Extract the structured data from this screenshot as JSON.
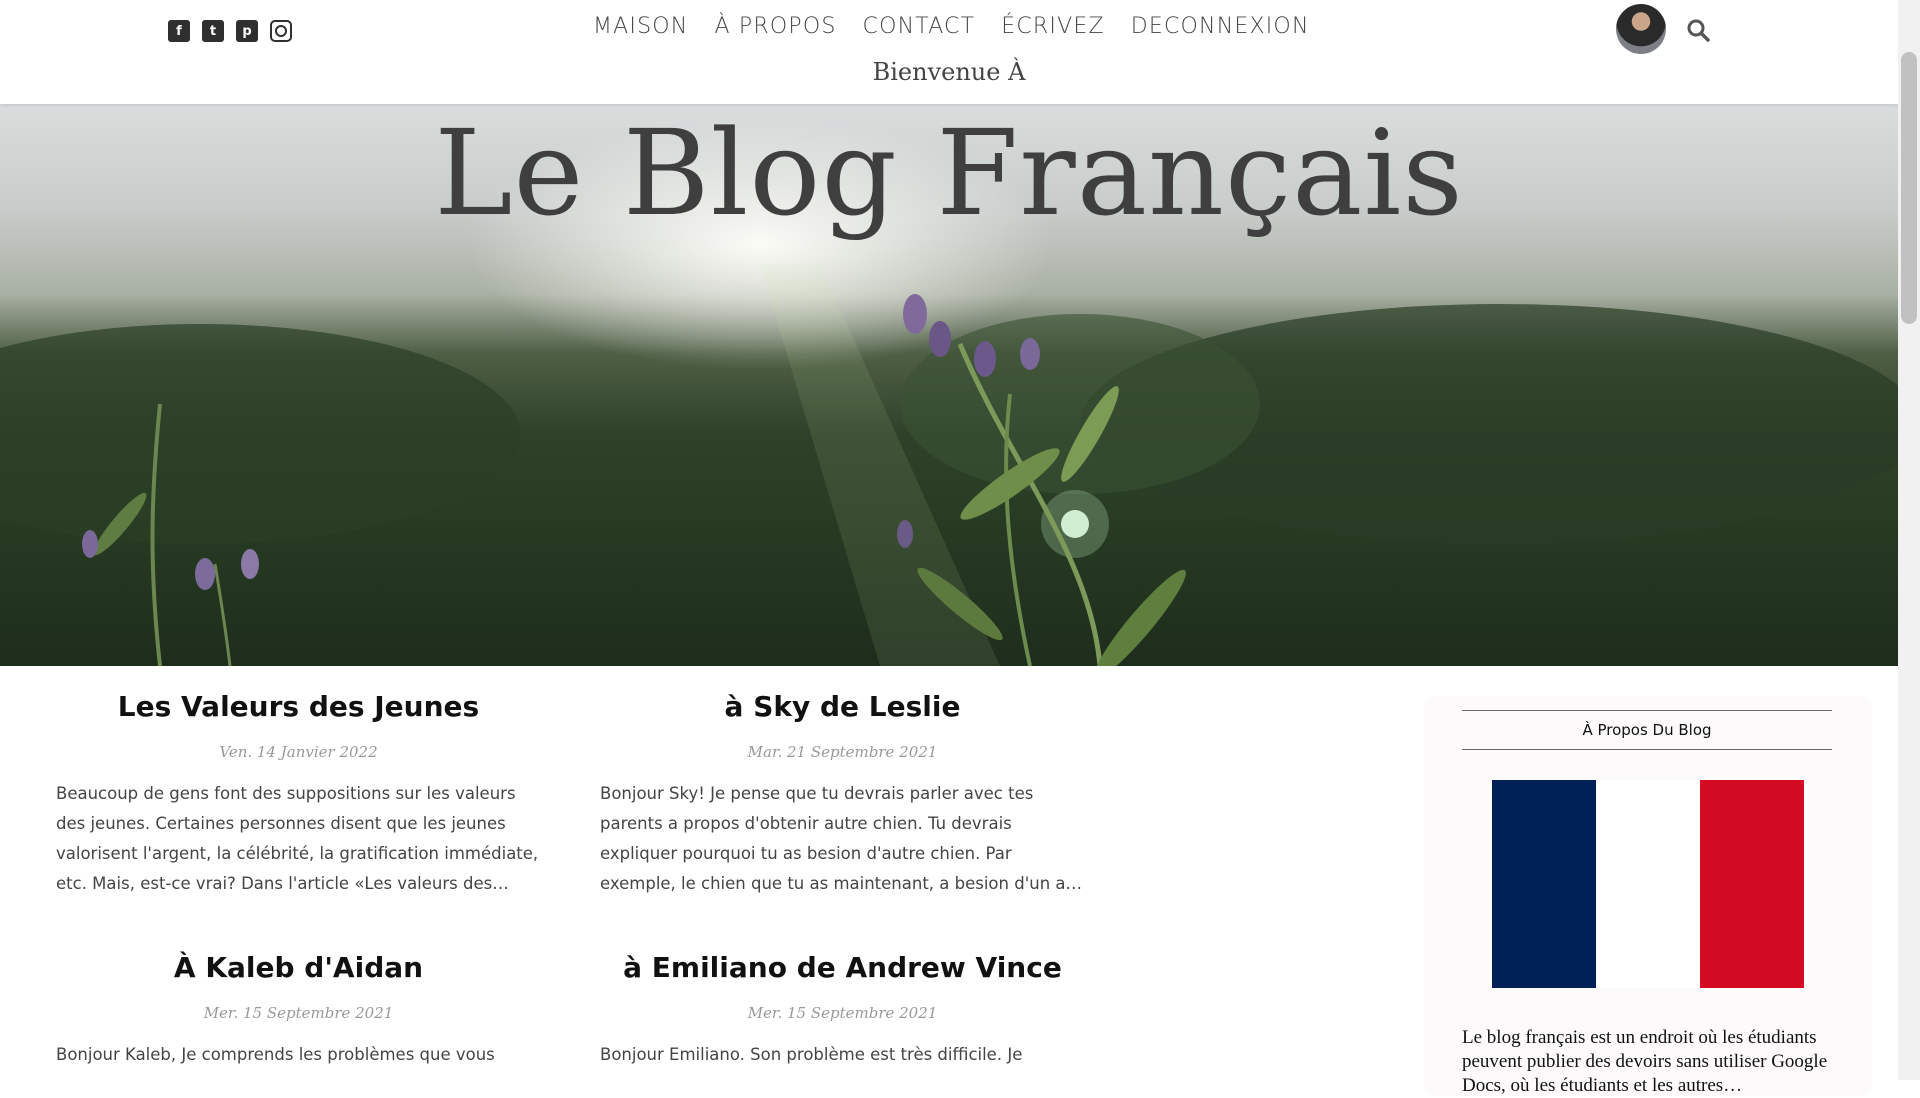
{
  "social": [
    "facebook-icon",
    "twitter-icon",
    "pinterest-icon",
    "instagram-icon"
  ],
  "nav": {
    "items": [
      "MAISON",
      "À PROPOS",
      "CONTACT",
      "ÉCRIVEZ",
      "DECONNEXION"
    ]
  },
  "header": {
    "welcome": "Bienvenue À",
    "search_icon": "search-icon"
  },
  "hero": {
    "title": "Le Blog Français"
  },
  "posts": [
    {
      "title": "Les Valeurs des Jeunes",
      "date": "Ven. 14 Janvier 2022",
      "excerpt": "Beaucoup de gens font des suppositions sur les valeurs des jeunes. Certaines personnes disent que les jeunes valorisent l'argent, la célébrité, la gratification immédiate, etc. Mais, est-ce vrai? Dans l'article «Les valeurs des…"
    },
    {
      "title": "à Sky de Leslie",
      "date": "Mar. 21 Septembre 2021",
      "excerpt": "Bonjour Sky! Je pense que tu devrais parler avec tes parents a propos d'obtenir autre chien. Tu devrais expliquer pourquoi tu as besion d'autre chien. Par exemple, le chien que tu as maintenant, a besion d'un a…"
    },
    {
      "title": "À Kaleb d'Aidan",
      "date": "Mer. 15 Septembre 2021",
      "excerpt": "Bonjour Kaleb, Je comprends les problèmes que vous"
    },
    {
      "title": "à Emiliano de Andrew Vince",
      "date": "Mer. 15 Septembre 2021",
      "excerpt": "Bonjour Emiliano. Son problème est très difficile. Je"
    }
  ],
  "sidebar": {
    "widget_title": "À Propos Du Blog",
    "about_text": "Le blog français est un endroit où les étudiants peuvent publier des devoirs sans utiliser Google Docs, où les étudiants et les autres…",
    "flag_colors": [
      "#002157",
      "#ffffff",
      "#d20a23"
    ]
  },
  "colors": {
    "text": "#111111",
    "nav": "#444444",
    "date": "#999999"
  }
}
